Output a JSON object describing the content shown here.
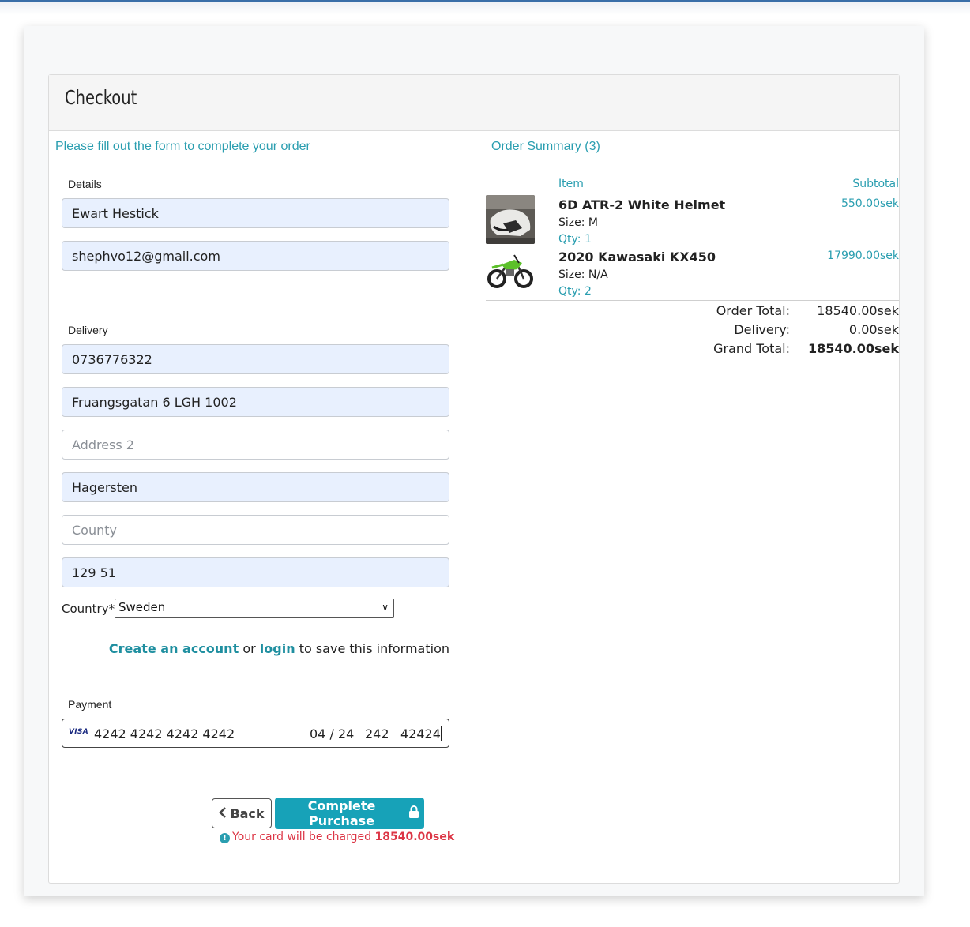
{
  "page": {
    "title": "Checkout",
    "form_prompt": "Please fill out the form to complete your order",
    "summary_title": "Order Summary (3)"
  },
  "details": {
    "label": "Details",
    "name_value": "Ewart Hestick",
    "email_value": "shephvo12@gmail.com"
  },
  "delivery": {
    "label": "Delivery",
    "phone_value": "0736776322",
    "address1_value": "Fruangsgatan 6 LGH 1002",
    "address2_placeholder": "Address 2",
    "city_value": "Hagersten",
    "county_placeholder": "County",
    "postcode_value": "129 51",
    "country_label": "Country*",
    "country_selected": "Sweden"
  },
  "account": {
    "create_link": "Create an account",
    "or_text": "or",
    "login_link": "login",
    "suffix_text": "to save this information"
  },
  "payment": {
    "label": "Payment",
    "card_brand": "VISA",
    "card_number": "4242 4242 4242 4242",
    "expiry": "04 / 24",
    "cvc": "242",
    "postal": "42424"
  },
  "actions": {
    "back_label": "Back",
    "complete_label": "Complete Purchase",
    "charge_note_prefix": "Your card will be charged",
    "charge_amount": "18540.00sek"
  },
  "summary": {
    "col_item": "Item",
    "col_subtotal": "Subtotal",
    "items": [
      {
        "name": "6D ATR-2 White Helmet",
        "size": "Size: M",
        "qty": "Qty: 1",
        "subtotal": "550.00sek",
        "thumb_icon": "helmet-image"
      },
      {
        "name": "2020 Kawasaki KX450",
        "size": "Size: N/A",
        "qty": "Qty: 2",
        "subtotal": "17990.00sek",
        "thumb_icon": "dirt-bike-image"
      }
    ],
    "order_total_label": "Order Total:",
    "order_total_value": "18540.00sek",
    "delivery_label": "Delivery:",
    "delivery_value": "0.00sek",
    "grand_total_label": "Grand Total:",
    "grand_total_value": "18540.00sek"
  },
  "colors": {
    "accent": "#17a2b8",
    "link": "#2a9eb0",
    "danger": "#dc3545",
    "autofill": "#e8f0fe"
  }
}
